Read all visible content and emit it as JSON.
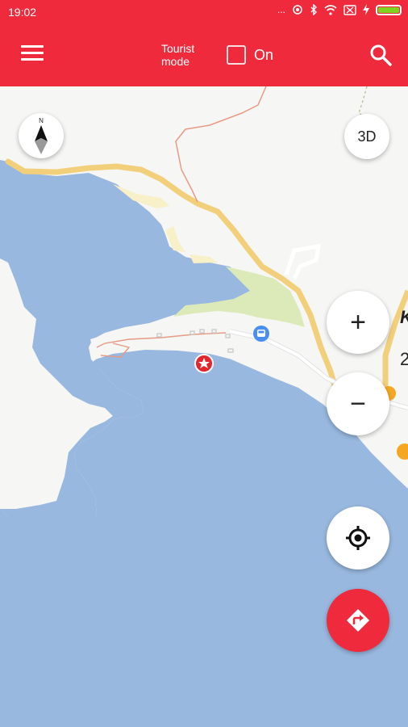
{
  "status_bar": {
    "time": "19:02",
    "dots": "...",
    "battery_color": "#7ed321"
  },
  "toolbar": {
    "background": "#ef2a3c",
    "menu_icon": "hamburger-icon",
    "tourist_mode_line1": "Tourist",
    "tourist_mode_line2": "mode",
    "toggle_label": "On",
    "toggle_checked": false,
    "search_icon": "search-icon"
  },
  "map": {
    "water_color": "#98b8df",
    "land_color": "#f6f6f4",
    "labels": {
      "edge_letter": "K",
      "edge_number": "2"
    },
    "markers": [
      "favorite-star-marker",
      "bus-stop-marker",
      "food-marker",
      "restaurant-marker"
    ]
  },
  "controls": {
    "compass_letter": "N",
    "mode_3d_label": "3D",
    "zoom_in_label": "+",
    "zoom_out_label": "−"
  }
}
